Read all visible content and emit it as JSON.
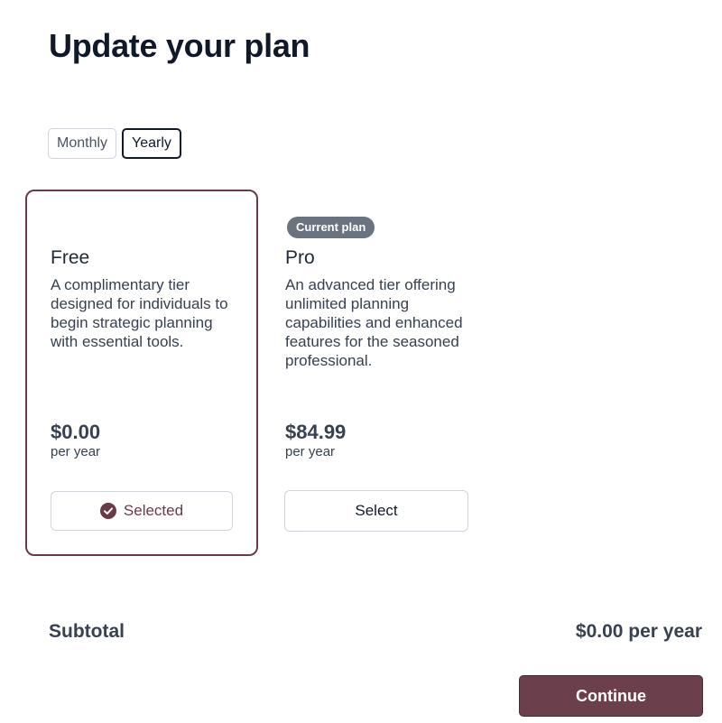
{
  "page": {
    "title": "Update your plan"
  },
  "billing_toggle": {
    "monthly_label": "Monthly",
    "yearly_label": "Yearly",
    "selected": "Yearly"
  },
  "plans": [
    {
      "name": "Free",
      "description": "A complimentary tier designed for individuals to begin strategic planning with essential tools.",
      "price": "$0.00",
      "period": "per year",
      "button_label": "Selected",
      "button_icon": "check-circle-icon",
      "selected": true
    },
    {
      "badge": "Current plan",
      "name": "Pro",
      "description": "An advanced tier offering unlimited planning capabilities and enhanced features for the seasoned professional.",
      "price": "$84.99",
      "period": "per year",
      "button_label": "Select",
      "selected": false
    }
  ],
  "summary": {
    "subtotal_label": "Subtotal",
    "subtotal_value": "$0.00 per year"
  },
  "actions": {
    "continue_label": "Continue"
  },
  "colors": {
    "accent": "#6b3f4c",
    "badge_bg": "#6b7280",
    "heading": "#111827"
  }
}
